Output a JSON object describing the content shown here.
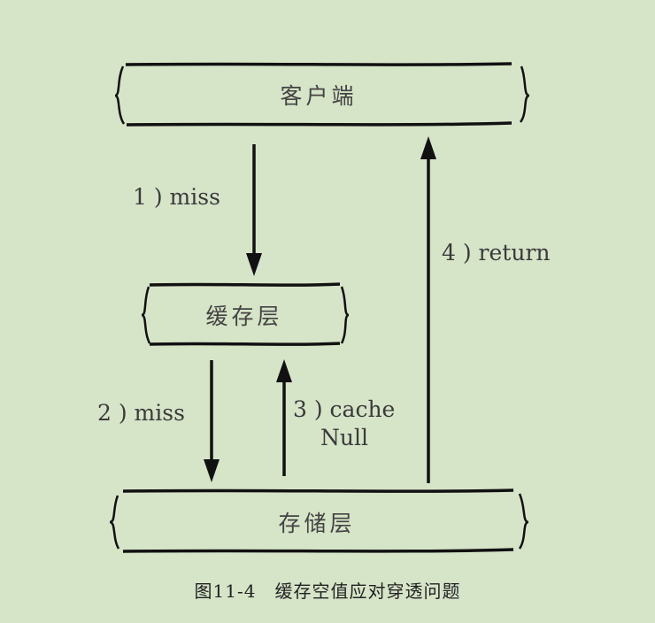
{
  "nodes": {
    "client": "客户端",
    "cache": "缓存层",
    "storage": "存储层"
  },
  "edges": {
    "step1": "1 ) miss",
    "step2": "2 ) miss",
    "step3_line1": "3 ) cache",
    "step3_line2": "Null",
    "step4": "4 ) return"
  },
  "caption": "图11-4　缓存空值应对穿透问题",
  "colors": {
    "background": "#d6e4c8",
    "stroke": "#111111",
    "text": "#444444"
  }
}
